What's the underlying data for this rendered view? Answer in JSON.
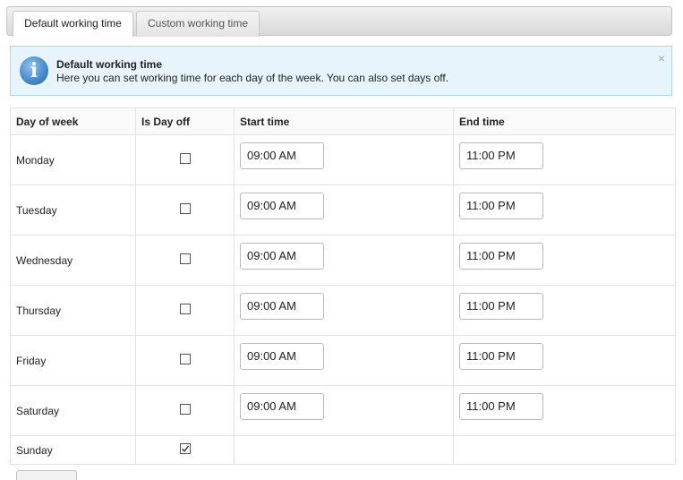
{
  "tabs": [
    {
      "label": "Default working time",
      "active": true
    },
    {
      "label": "Custom working time",
      "active": false
    }
  ],
  "info": {
    "icon": "info-icon",
    "title": "Default working time",
    "text": "Here you can set working time for each day of the week. You can also set days off.",
    "close": "×"
  },
  "table": {
    "headers": [
      "Day of week",
      "Is Day off",
      "Start time",
      "End time"
    ],
    "rows": [
      {
        "day": "Monday",
        "day_off": false,
        "start": "09:00 AM",
        "end": "11:00 PM"
      },
      {
        "day": "Tuesday",
        "day_off": false,
        "start": "09:00 AM",
        "end": "11:00 PM"
      },
      {
        "day": "Wednesday",
        "day_off": false,
        "start": "09:00 AM",
        "end": "11:00 PM"
      },
      {
        "day": "Thursday",
        "day_off": false,
        "start": "09:00 AM",
        "end": "11:00 PM"
      },
      {
        "day": "Friday",
        "day_off": false,
        "start": "09:00 AM",
        "end": "11:00 PM"
      },
      {
        "day": "Saturday",
        "day_off": false,
        "start": "09:00 AM",
        "end": "11:00 PM"
      },
      {
        "day": "Sunday",
        "day_off": true,
        "start": "",
        "end": ""
      }
    ]
  },
  "colors": {
    "info_bg": "#e8f4fb",
    "info_border": "#b0d6eb",
    "info_icon": "#3a7dc4"
  }
}
